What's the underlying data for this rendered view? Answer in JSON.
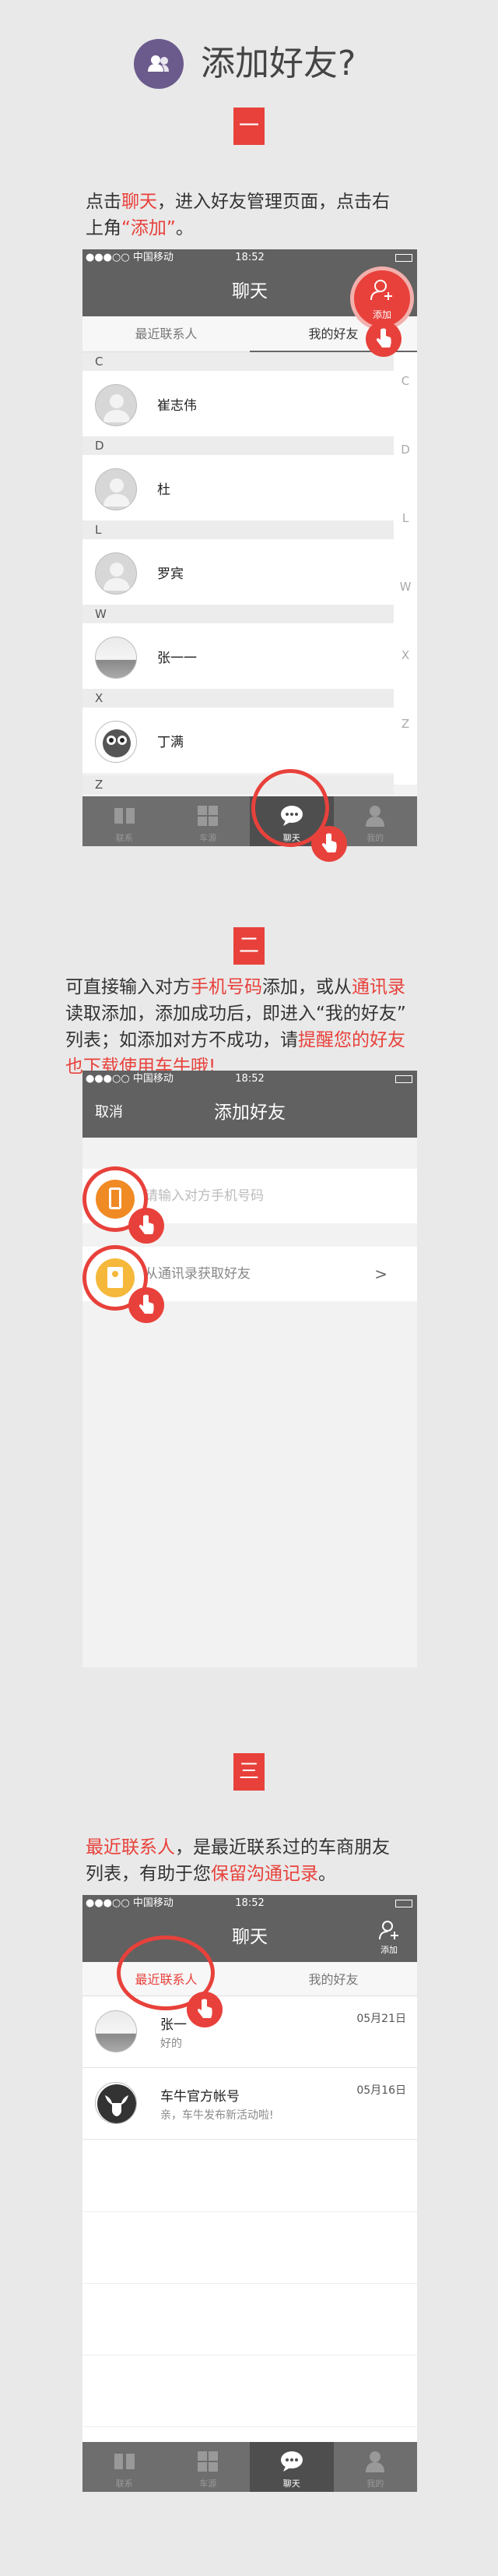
{
  "header": {
    "title": "添加好友?",
    "icon": "users-icon"
  },
  "steps": [
    {
      "badge": "一",
      "desc": [
        {
          "t": "点击",
          "h": false
        },
        {
          "t": "聊天",
          "h": true
        },
        {
          "t": "，进入好友管理页面，点击右",
          "h": false
        },
        {
          "t": "\n上角",
          "h": false
        },
        {
          "t": "“添加”",
          "h": true
        },
        {
          "t": "。",
          "h": false
        }
      ]
    },
    {
      "badge": "二",
      "desc": [
        {
          "t": "可直接输入对方",
          "h": false
        },
        {
          "t": "手机号码",
          "h": true
        },
        {
          "t": "添加，或从",
          "h": false
        },
        {
          "t": "通讯录",
          "h": true
        },
        {
          "t": "\n读取添加，添加成功后，即进入“我的好友”\n列表；如添加对方不成功，请",
          "h": false
        },
        {
          "t": "提醒您的好友\n也下载使用车牛哦!",
          "h": true
        }
      ]
    },
    {
      "badge": "三",
      "desc": [
        {
          "t": "最近联系人",
          "h": true
        },
        {
          "t": "，是最近联系过的车商朋友\n列表，有助于您",
          "h": false
        },
        {
          "t": "保留沟通记录",
          "h": true
        },
        {
          "t": "。",
          "h": false
        }
      ]
    }
  ],
  "statusbar": {
    "carrier": "●●●○○ 中国移动",
    "time": "18:52"
  },
  "screen1": {
    "title": "聊天",
    "add_label": "添加",
    "tabs": [
      "最近联系人",
      "我的好友"
    ],
    "sections": [
      {
        "letter": "C",
        "name": "崔志伟",
        "avatar": "default"
      },
      {
        "letter": "D",
        "name": "杜",
        "avatar": "default"
      },
      {
        "letter": "L",
        "name": "罗宾",
        "avatar": "default"
      },
      {
        "letter": "W",
        "name": "张一一",
        "avatar": "photo"
      },
      {
        "letter": "X",
        "name": "丁满",
        "avatar": "owl"
      }
    ],
    "last_letter": "Z",
    "index": [
      "C",
      "D",
      "L",
      "W",
      "X",
      "Z"
    ]
  },
  "tabbar": {
    "items": [
      "联系",
      "车源",
      "聊天",
      "我的"
    ],
    "active": 2
  },
  "screen2": {
    "title": "添加好友",
    "cancel": "取消",
    "phone_placeholder": "请输入对方手机号码",
    "contacts_label": "从通讯录获取好友",
    "chevron": ">"
  },
  "screen3": {
    "title": "聊天",
    "add_label": "添加",
    "tabs": [
      "最近联系人",
      "我的好友"
    ],
    "items": [
      {
        "name": "张一",
        "msg": "好的",
        "date": "05月21日"
      },
      {
        "name": "车牛官方帐号",
        "msg": "亲，车牛发布新活动啦!",
        "date": "05月16日"
      }
    ]
  },
  "colors": {
    "accent": "#e8413b",
    "nav": "#616161",
    "header_icon": "#6b5a8c"
  }
}
